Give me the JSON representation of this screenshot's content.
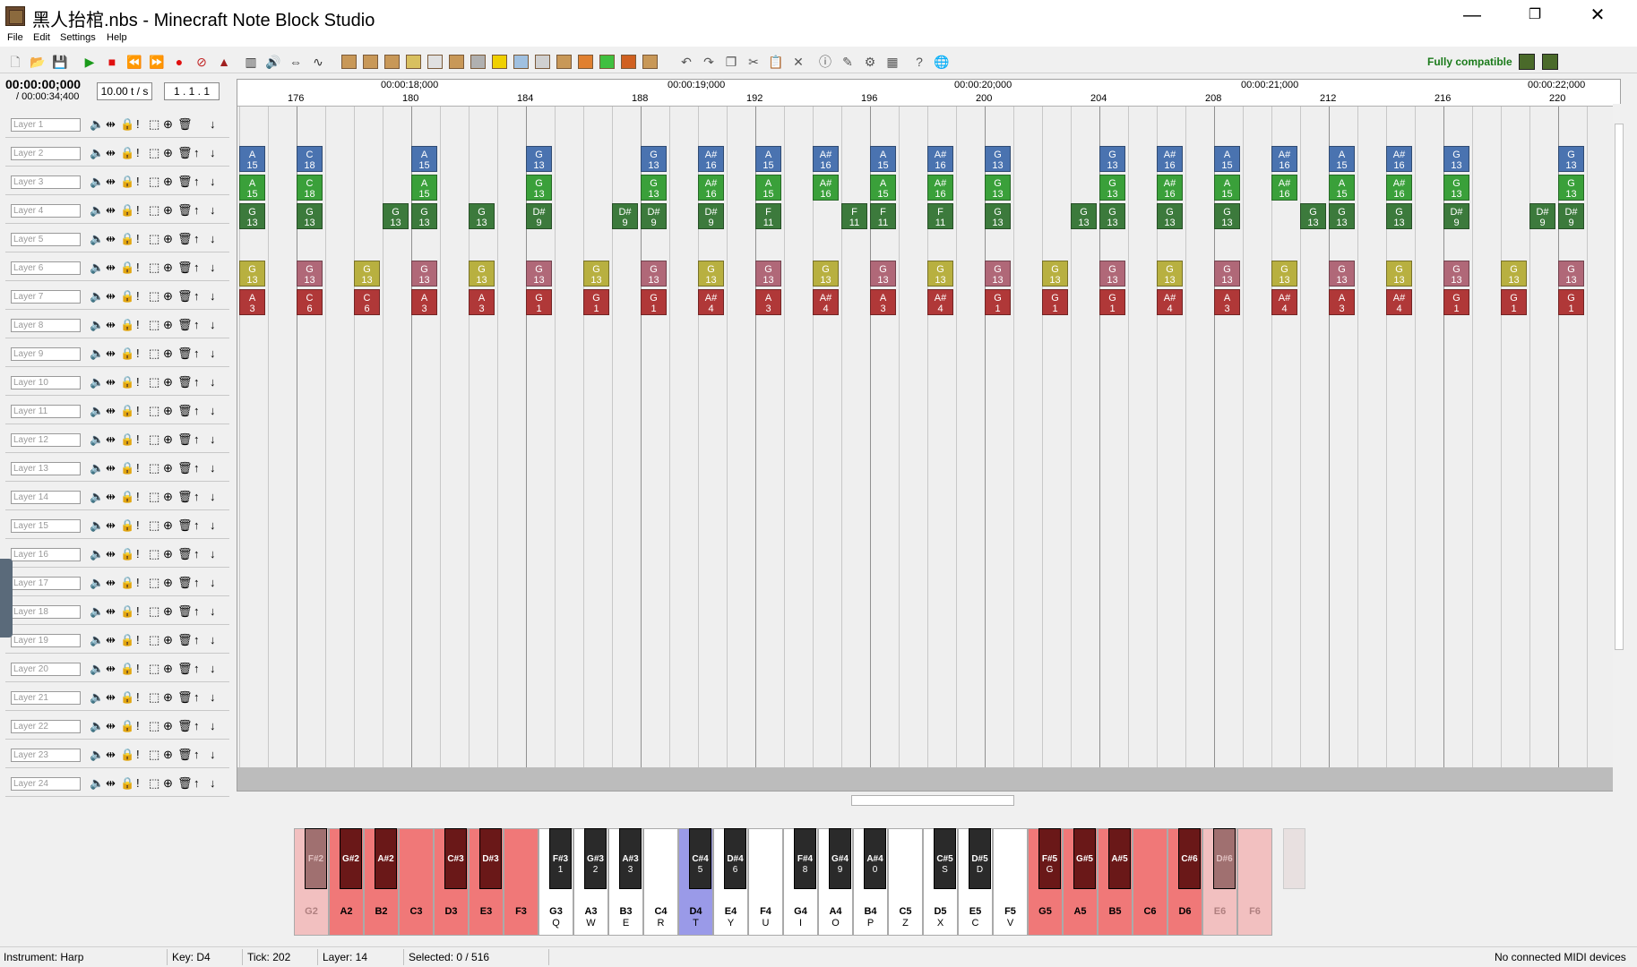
{
  "window": {
    "title": "黑人抬棺.nbs - Minecraft Note Block Studio",
    "minimize": "—",
    "maximize": "❐",
    "close": "✕"
  },
  "menu": [
    "File",
    "Edit",
    "Settings",
    "Help"
  ],
  "toolbar": {
    "compat_label": "Fully compatible"
  },
  "transport": {
    "time": "00:00:00;000",
    "total": "/ 00:00:34;400",
    "tempo": "10.00 t / s",
    "position": "1 . 1 . 1"
  },
  "layers": [
    "Layer 1",
    "Layer 2",
    "Layer 3",
    "Layer 4",
    "Layer 5",
    "Layer 6",
    "Layer 7",
    "Layer 8",
    "Layer 9",
    "Layer 10",
    "Layer 11",
    "Layer 12",
    "Layer 13",
    "Layer 14",
    "Layer 15",
    "Layer 16",
    "Layer 17",
    "Layer 18",
    "Layer 19",
    "Layer 20",
    "Layer 21",
    "Layer 22",
    "Layer 23",
    "Layer 24"
  ],
  "ruler": {
    "times": [
      "00:00:18;000",
      "00:00:19;000",
      "00:00:20;000",
      "00:00:21;000",
      "00:00:22;000"
    ],
    "ticks": [
      "176",
      "180",
      "184",
      "188",
      "192",
      "196",
      "200",
      "204",
      "208",
      "212",
      "216",
      "220"
    ]
  },
  "colors": {
    "blue": "#4a73b0",
    "green": "#3aa03a",
    "darkgreen": "#3c7a3c",
    "yellow": "#b8b040",
    "pink": "#b06878",
    "red": "#b03838"
  },
  "notes": {
    "layer2": [
      [
        0,
        "A",
        "15"
      ],
      [
        2,
        "C",
        "18"
      ],
      [
        6,
        "A",
        "15"
      ],
      [
        10,
        "G",
        "13"
      ],
      [
        14,
        "G",
        "13"
      ],
      [
        16,
        "A#",
        "16"
      ],
      [
        18,
        "A",
        "15"
      ],
      [
        20,
        "A#",
        "16"
      ],
      [
        22,
        "A",
        "15"
      ],
      [
        24,
        "A#",
        "16"
      ],
      [
        26,
        "G",
        "13"
      ],
      [
        30,
        "G",
        "13"
      ],
      [
        32,
        "A#",
        "16"
      ],
      [
        34,
        "A",
        "15"
      ],
      [
        36,
        "A#",
        "16"
      ],
      [
        38,
        "A",
        "15"
      ],
      [
        40,
        "A#",
        "16"
      ],
      [
        42,
        "G",
        "13"
      ],
      [
        46,
        "G",
        "13"
      ]
    ],
    "layer3": [
      [
        0,
        "A",
        "15"
      ],
      [
        2,
        "C",
        "18"
      ],
      [
        6,
        "A",
        "15"
      ],
      [
        10,
        "G",
        "13"
      ],
      [
        14,
        "G",
        "13"
      ],
      [
        16,
        "A#",
        "16"
      ],
      [
        18,
        "A",
        "15"
      ],
      [
        20,
        "A#",
        "16"
      ],
      [
        22,
        "A",
        "15"
      ],
      [
        24,
        "A#",
        "16"
      ],
      [
        26,
        "G",
        "13"
      ],
      [
        30,
        "G",
        "13"
      ],
      [
        32,
        "A#",
        "16"
      ],
      [
        34,
        "A",
        "15"
      ],
      [
        36,
        "A#",
        "16"
      ],
      [
        38,
        "A",
        "15"
      ],
      [
        40,
        "A#",
        "16"
      ],
      [
        42,
        "G",
        "13"
      ],
      [
        46,
        "G",
        "13"
      ]
    ],
    "layer4": [
      [
        0,
        "G",
        "13"
      ],
      [
        2,
        "G",
        "13"
      ],
      [
        5,
        "G",
        "13"
      ],
      [
        6,
        "G",
        "13"
      ],
      [
        8,
        "G",
        "13"
      ],
      [
        10,
        "D#",
        "9"
      ],
      [
        13,
        "D#",
        "9"
      ],
      [
        14,
        "D#",
        "9"
      ],
      [
        16,
        "D#",
        "9"
      ],
      [
        18,
        "F",
        "11"
      ],
      [
        21,
        "F",
        "11"
      ],
      [
        22,
        "F",
        "11"
      ],
      [
        24,
        "F",
        "11"
      ],
      [
        26,
        "G",
        "13"
      ],
      [
        29,
        "G",
        "13"
      ],
      [
        30,
        "G",
        "13"
      ],
      [
        32,
        "G",
        "13"
      ],
      [
        34,
        "G",
        "13"
      ],
      [
        37,
        "G",
        "13"
      ],
      [
        38,
        "G",
        "13"
      ],
      [
        40,
        "G",
        "13"
      ],
      [
        42,
        "D#",
        "9"
      ],
      [
        45,
        "D#",
        "9"
      ],
      [
        46,
        "D#",
        "9"
      ]
    ],
    "layer6": [
      [
        0,
        "G",
        "13",
        "y"
      ],
      [
        2,
        "G",
        "13",
        "p"
      ],
      [
        4,
        "G",
        "13",
        "y"
      ],
      [
        6,
        "G",
        "13",
        "p"
      ],
      [
        8,
        "G",
        "13",
        "y"
      ],
      [
        10,
        "G",
        "13",
        "p"
      ],
      [
        12,
        "G",
        "13",
        "y"
      ],
      [
        14,
        "G",
        "13",
        "p"
      ],
      [
        16,
        "G",
        "13",
        "y"
      ],
      [
        18,
        "G",
        "13",
        "p"
      ],
      [
        20,
        "G",
        "13",
        "y"
      ],
      [
        22,
        "G",
        "13",
        "p"
      ],
      [
        24,
        "G",
        "13",
        "y"
      ],
      [
        26,
        "G",
        "13",
        "p"
      ],
      [
        28,
        "G",
        "13",
        "y"
      ],
      [
        30,
        "G",
        "13",
        "p"
      ],
      [
        32,
        "G",
        "13",
        "y"
      ],
      [
        34,
        "G",
        "13",
        "p"
      ],
      [
        36,
        "G",
        "13",
        "y"
      ],
      [
        38,
        "G",
        "13",
        "p"
      ],
      [
        40,
        "G",
        "13",
        "y"
      ],
      [
        42,
        "G",
        "13",
        "p"
      ],
      [
        44,
        "G",
        "13",
        "y"
      ],
      [
        46,
        "G",
        "13",
        "p"
      ]
    ],
    "layer7": [
      [
        0,
        "A",
        "3"
      ],
      [
        2,
        "C",
        "6"
      ],
      [
        4,
        "C",
        "6"
      ],
      [
        6,
        "A",
        "3"
      ],
      [
        8,
        "A",
        "3"
      ],
      [
        10,
        "G",
        "1"
      ],
      [
        12,
        "G",
        "1"
      ],
      [
        14,
        "G",
        "1"
      ],
      [
        16,
        "A#",
        "4"
      ],
      [
        18,
        "A",
        "3"
      ],
      [
        20,
        "A#",
        "4"
      ],
      [
        22,
        "A",
        "3"
      ],
      [
        24,
        "A#",
        "4"
      ],
      [
        26,
        "G",
        "1"
      ],
      [
        28,
        "G",
        "1"
      ],
      [
        30,
        "G",
        "1"
      ],
      [
        32,
        "A#",
        "4"
      ],
      [
        34,
        "A",
        "3"
      ],
      [
        36,
        "A#",
        "4"
      ],
      [
        38,
        "A",
        "3"
      ],
      [
        40,
        "A#",
        "4"
      ],
      [
        42,
        "G",
        "1"
      ],
      [
        44,
        "G",
        "1"
      ],
      [
        46,
        "G",
        "1"
      ]
    ]
  },
  "piano": {
    "white": [
      [
        "G2",
        ""
      ],
      [
        "A2",
        ""
      ],
      [
        "B2",
        ""
      ],
      [
        "C3",
        ""
      ],
      [
        "D3",
        ""
      ],
      [
        "E3",
        ""
      ],
      [
        "F3",
        ""
      ],
      [
        "G3",
        "Q"
      ],
      [
        "A3",
        "W"
      ],
      [
        "B3",
        "E"
      ],
      [
        "C4",
        "R"
      ],
      [
        "D4",
        "T"
      ],
      [
        "E4",
        "Y"
      ],
      [
        "F4",
        "U"
      ],
      [
        "G4",
        "I"
      ],
      [
        "A4",
        "O"
      ],
      [
        "B4",
        "P"
      ],
      [
        "C5",
        "Z"
      ],
      [
        "D5",
        "X"
      ],
      [
        "E5",
        "C"
      ],
      [
        "F5",
        "V"
      ],
      [
        "G5",
        ""
      ],
      [
        "A5",
        ""
      ],
      [
        "B5",
        ""
      ],
      [
        "C6",
        ""
      ],
      [
        "D6",
        ""
      ],
      [
        "E6",
        ""
      ],
      [
        "F6",
        ""
      ]
    ],
    "black": [
      [
        0,
        "F#2",
        ""
      ],
      [
        1,
        "G#2",
        ""
      ],
      [
        2,
        "A#2",
        ""
      ],
      [
        4,
        "C#3",
        ""
      ],
      [
        5,
        "D#3",
        ""
      ],
      [
        7,
        "F#3",
        "1"
      ],
      [
        8,
        "G#3",
        "2"
      ],
      [
        9,
        "A#3",
        "3"
      ],
      [
        11,
        "C#4",
        "5"
      ],
      [
        12,
        "D#4",
        "6"
      ],
      [
        14,
        "F#4",
        "8"
      ],
      [
        15,
        "G#4",
        "9"
      ],
      [
        16,
        "A#4",
        "0"
      ],
      [
        18,
        "C#5",
        "S"
      ],
      [
        19,
        "D#5",
        "D"
      ],
      [
        21,
        "F#5",
        "G"
      ],
      [
        22,
        "G#5",
        ""
      ],
      [
        23,
        "A#5",
        ""
      ],
      [
        25,
        "C#6",
        ""
      ],
      [
        26,
        "D#6",
        ""
      ],
      [
        28,
        "",
        ""
      ]
    ]
  },
  "status": {
    "instrument": "Instrument: Harp",
    "key": "Key: D4",
    "tick": "Tick: 202",
    "layer": "Layer: 14",
    "selected": "Selected: 0 / 516",
    "midi": "No connected MIDI devices"
  }
}
